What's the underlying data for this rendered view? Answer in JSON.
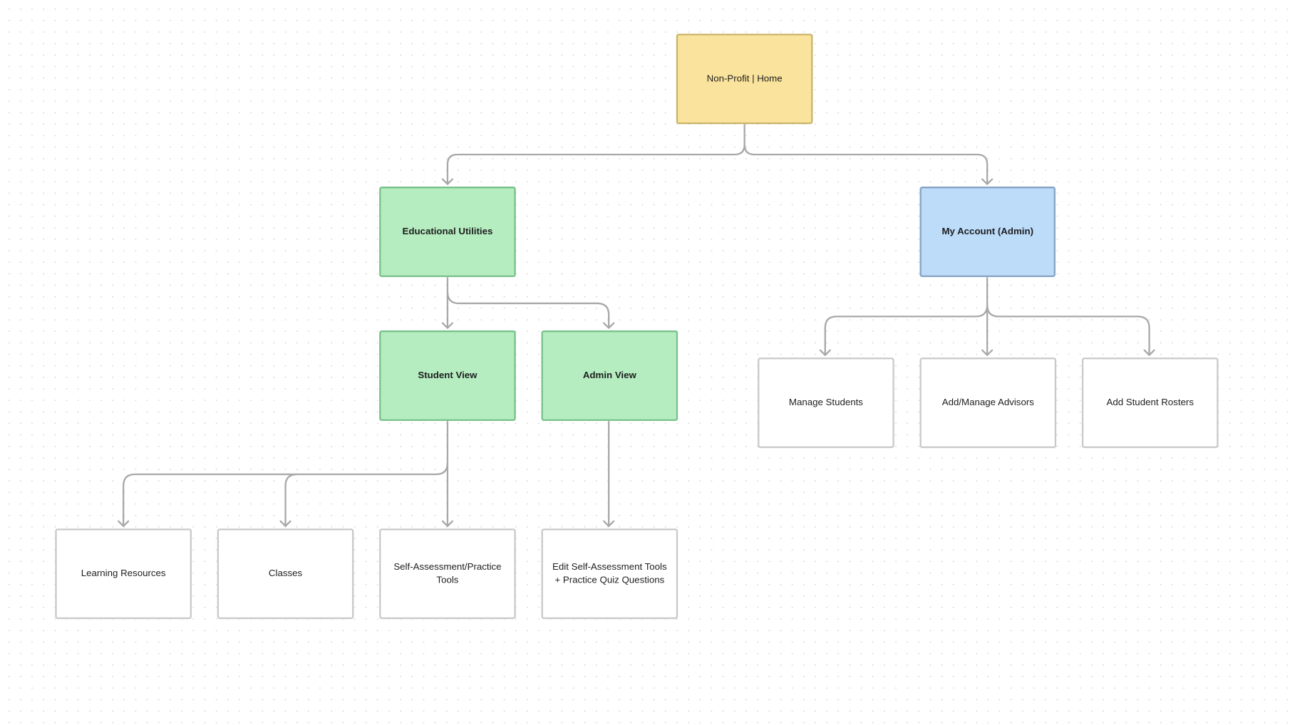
{
  "colors": {
    "root": "#fae39c",
    "section": "#b5edc1",
    "account": "#bcdcfa",
    "leaf": "#ffffff",
    "connector": "#a8a8a8"
  },
  "nodes": {
    "home": "Non-Profit | Home",
    "educational_utilities": "Educational Utilities",
    "my_account": "My Account (Admin)",
    "student_view": "Student View",
    "admin_view": "Admin View",
    "manage_students": "Manage Students",
    "add_manage_advisors": "Add/Manage Advisors",
    "add_student_rosters": "Add Student Rosters",
    "learning_resources": "Learning Resources",
    "classes": "Classes",
    "self_assessment": "Self-Assessment/Practice Tools",
    "edit_self_assessment": "Edit Self-Assessment Tools + Practice Quiz Questions"
  }
}
